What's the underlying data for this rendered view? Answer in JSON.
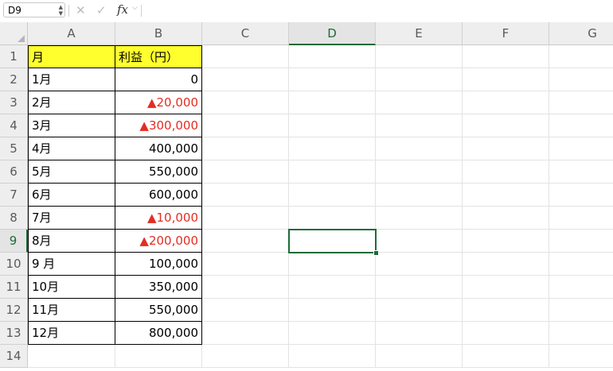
{
  "formula_bar": {
    "name_box": "D9",
    "cancel_icon": "close-icon",
    "confirm_icon": "check-icon",
    "fx_label": "fx",
    "formula": ""
  },
  "columns": [
    "A",
    "B",
    "C",
    "D",
    "E",
    "F",
    "G"
  ],
  "rows": [
    "1",
    "2",
    "3",
    "4",
    "5",
    "6",
    "7",
    "8",
    "9",
    "10",
    "11",
    "12",
    "13",
    "14"
  ],
  "table": {
    "header": {
      "month": "月",
      "profit": "利益（円）"
    },
    "data": [
      {
        "month": "1月",
        "profit": "0",
        "negative": false
      },
      {
        "month": "2月",
        "profit": "▲20,000",
        "negative": true
      },
      {
        "month": "3月",
        "profit": "▲300,000",
        "negative": true
      },
      {
        "month": "4月",
        "profit": "400,000",
        "negative": false
      },
      {
        "month": "5月",
        "profit": "550,000",
        "negative": false
      },
      {
        "month": "6月",
        "profit": "600,000",
        "negative": false
      },
      {
        "month": "7月",
        "profit": "▲10,000",
        "negative": true
      },
      {
        "month": "8月",
        "profit": "▲200,000",
        "negative": true
      },
      {
        "month": "9 月",
        "profit": "100,000",
        "negative": false
      },
      {
        "month": "10月",
        "profit": "350,000",
        "negative": false
      },
      {
        "month": "11月",
        "profit": "550,000",
        "negative": false
      },
      {
        "month": "12月",
        "profit": "800,000",
        "negative": false
      }
    ]
  },
  "selection": {
    "cell": "D9",
    "column": "D",
    "row": "9"
  },
  "colors": {
    "accent": "#1e6b38",
    "negative": "#e42d22",
    "header_fill": "#ffff2e",
    "grid_line": "#e3e3e3",
    "header_bg": "#eeeeee"
  }
}
